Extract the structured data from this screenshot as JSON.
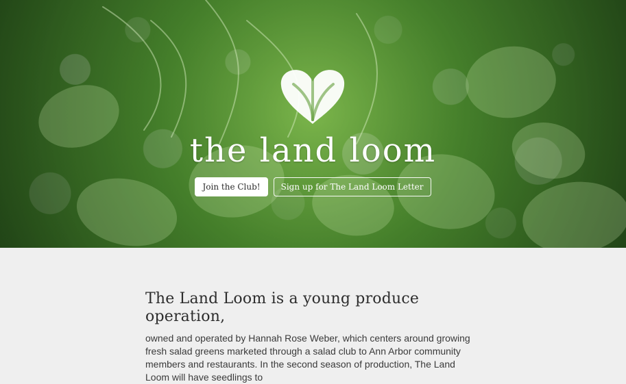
{
  "hero": {
    "title": "the land loom",
    "logo_icon": "heart-leaf-logo-icon",
    "buttons": {
      "join": "Join the Club!",
      "signup": "Sign up for The Land Loom Letter"
    }
  },
  "intro": {
    "heading": "The Land Loom is a young produce operation,",
    "body": "owned and operated by Hannah Rose Weber, which centers around growing fresh salad greens marketed through a salad club to Ann Arbor community members and restaurants. In the second season of production, The Land Loom will have seedlings to"
  },
  "colors": {
    "page_background": "#efefef",
    "hero_green": "#4c8d2f",
    "text_dark": "#2d2d2d"
  }
}
